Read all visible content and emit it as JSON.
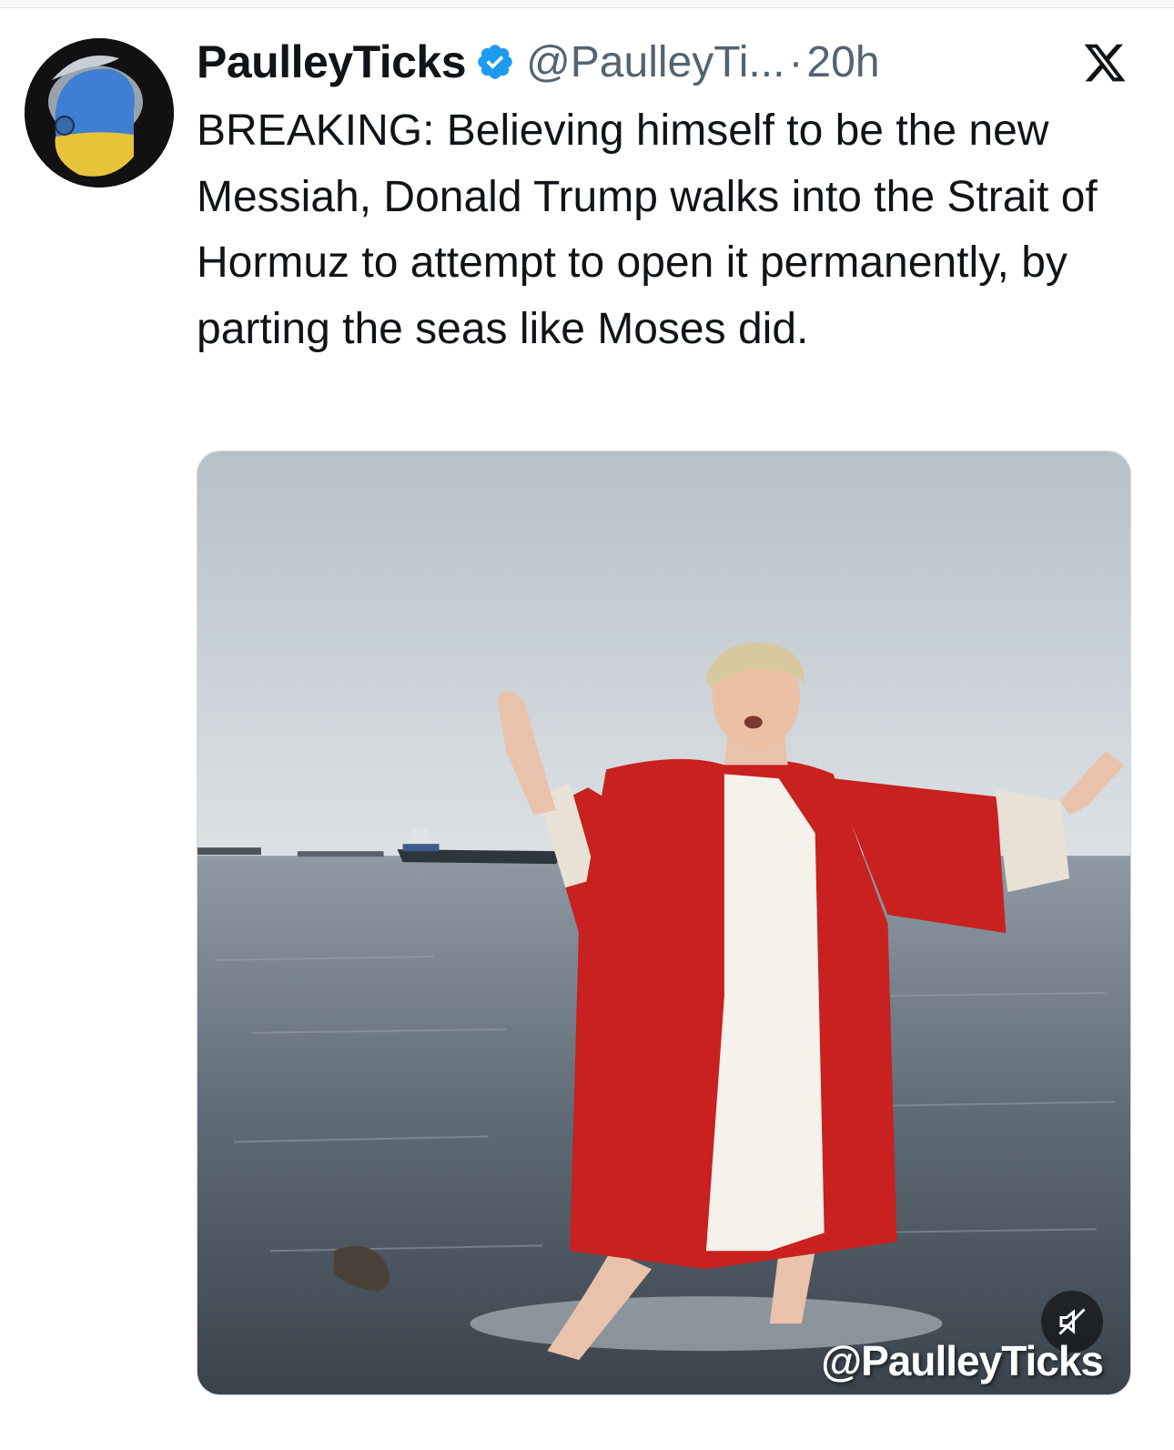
{
  "tweet": {
    "display_name": "PaulleyTicks",
    "handle": "@PaulleyTi...",
    "separator": "·",
    "time": "20h",
    "text": "BREAKING: Believing himself to be the new Messiah, Donald Trump walks into the Strait of Hormuz to attempt to open it permanently, by parting the seas like Moses did.",
    "verified_color": "#1d9bf0"
  },
  "media": {
    "watermark": "@PaulleyTicks",
    "mute_icon": "speaker-muted-icon"
  },
  "icons": {
    "platform_logo": "x-logo-icon",
    "verified": "verified-badge-icon"
  },
  "colors": {
    "text_primary": "#0f1419",
    "text_secondary": "#536471",
    "robe_red": "#c8211f"
  }
}
